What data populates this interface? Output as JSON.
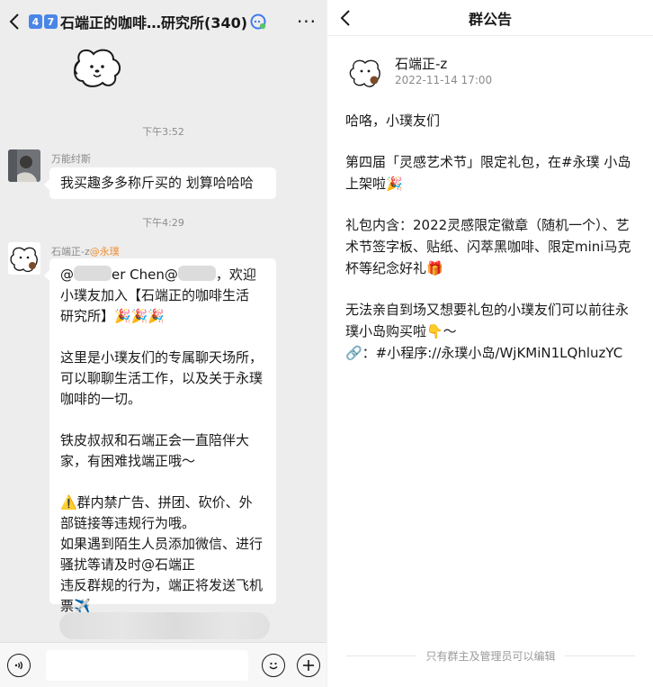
{
  "left": {
    "nums": [
      "4",
      "7"
    ],
    "title": "石端正的咖啡…研究所(340)",
    "more": "···",
    "time1": "下午3:52",
    "msg1": {
      "sender": "万能纣斯",
      "text": "我买趣多多称斤买的 划算哈哈哈"
    },
    "time2": "下午4:29",
    "msg2": {
      "sender": "石端正-z",
      "sender_tag": "@永璞",
      "line1_a": "@",
      "line1_b": "er Chen@",
      "line1_c": "，欢迎",
      "line2": "小璞友加入【石端正的咖啡生活",
      "line3": "研究所】🎉🎉🎉",
      "para2": "这里是小璞友们的专属聊天场所，可以聊聊生活工作，以及关于永璞咖啡的一切。",
      "para3": "铁皮叔叔和石端正会一直陪伴大家，有困难找端正哦～",
      "para4": "⚠️群内禁广告、拼团、砍价、外部链接等违规行为哦。",
      "para5a": "如果遇到陌生人员添加微信、进行骚扰等请及时@石端正",
      "para5b": "违反群规的行为，端正将发送飞机票✈️"
    }
  },
  "right": {
    "title": "群公告",
    "author": "石端正-z",
    "date": "2022-11-14 17:00",
    "p1": "哈咯，小璞友们",
    "p2": "第四届「灵感艺术节」限定礼包，在#永璞 小岛上架啦🎉",
    "p3": "礼包内含：2022灵感限定徽章（随机一个）、艺术节签字板、贴纸、闪萃黑咖啡、限定mini马克杯等纪念好礼🎁",
    "p4a": "无法亲自到场又想要礼包的小璞友们可以前往永璞小岛购买啦👇～",
    "p4b": "🔗：#小程序://永璞小岛/WjKMiN1LQhluzYC",
    "footer": "只有群主及管理员可以编辑"
  },
  "colors": {
    "chat_bg": "#ededed",
    "bubble_bg": "#ffffff",
    "timestamp": "#8d8d8d",
    "tag_orange": "#ef8f36",
    "num_blue": "#4a86e8"
  },
  "icons": [
    "back-icon",
    "ai-assistant-icon",
    "more-icon",
    "voice-icon",
    "emoji-icon",
    "plus-icon"
  ]
}
